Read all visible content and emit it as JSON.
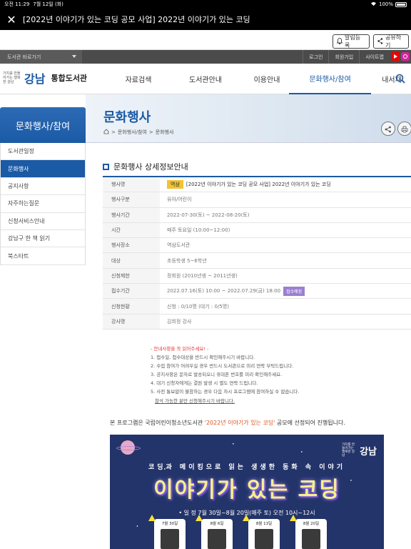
{
  "status_bar": {
    "time": "오전 11:29",
    "date": "7월 12일 (화)",
    "battery": "100%"
  },
  "window": {
    "title": "[2022년 이야기가 있는 코딩 공모 사업] 2022년 이야기가 있는 코딩"
  },
  "actions": {
    "alarm": "알림등록",
    "share": "공유하기"
  },
  "utility": {
    "library_select": "도서관 바로가기",
    "links": [
      "로그인",
      "회원가입",
      "사이트맵"
    ]
  },
  "header": {
    "logo_slogan": "가치를 만들어가는 행복한 강남",
    "logo_city": "강남",
    "logo_lib": "통합도서관",
    "nav": [
      "자료검색",
      "도서관안내",
      "이용안내",
      "문화행사/참여",
      "내서재"
    ]
  },
  "banner": {
    "title": "문화행사",
    "breadcrumb": [
      "문화행사/참여",
      "문화행사"
    ]
  },
  "sidebar": {
    "title": "문화행사/참여",
    "items": [
      "도서관일정",
      "문화행사",
      "공지사항",
      "자주하는질문",
      "신청서비스안내",
      "강남구 한 책 읽기",
      "북스타트"
    ]
  },
  "section_title": "문화행사 상세정보안내",
  "details": {
    "rows": [
      {
        "label": "행사명",
        "badge": "역삼",
        "value": "[2022년 이야기가 있는 코딩 공모 사업] 2022년 이야기가 있는 코딩"
      },
      {
        "label": "행사구분",
        "value": "유아/어린이"
      },
      {
        "label": "행사기간",
        "value": "2022-07-30(토) ~ 2022-08-20(토)"
      },
      {
        "label": "시간",
        "value": "매주 토요일 (10:00~12:00)"
      },
      {
        "label": "행사장소",
        "value": "역삼도서관"
      },
      {
        "label": "대상",
        "value": "초등학생 5~6학년"
      },
      {
        "label": "신청제한",
        "value": "정회원 (2010년생 ~ 2011년생)"
      },
      {
        "label": "접수기간",
        "value": "2022.07.16(토) 10:00 ~ 2022.07.29(금) 18:00",
        "status": "접수예정"
      },
      {
        "label": "신청현황",
        "value": "신청 : 0/10명 (대기 : 0/5명)"
      },
      {
        "label": "강사명",
        "value": "김희정 강사"
      }
    ]
  },
  "notice": {
    "heading": "- 안내사항을 꼭 읽어주세요! -",
    "items": [
      "1. 접수일, 접수대상을 반드시 확인해주시기 바랍니다.",
      "2. 수업 참여가 어려우실 경우 반드시 도서관으로 미리 연락 부탁드립니다.",
      "3. 공지사항은 문자로 발송되오니 휴대폰 번호를 미리 확인해주세요.",
      "4. 대기 신청자에게는 결원 발생 시 별도 연락 드립니다.",
      "5. 사전 통보없이 불참하는 경우 다음 차시 프로그램에 참여하실 수 없습니다."
    ],
    "link": "참석 가능한 분만 신청해주시기 바랍니다."
  },
  "intro": {
    "before": "본 프로그램은 국립어린이청소년도서관 ",
    "highlight": "'2022년 이야기가 있는 코딩'",
    "after": " 공모에 선정되어 진행됩니다."
  },
  "poster": {
    "logo_slogan": "가치를 만들어가는 행복한 강남",
    "logo_city": "강남",
    "subtitle": "코딩과 메이킹으로 읽는 생생한 동화 속 이야기",
    "main": "이야기가 있는 코딩",
    "schedule": "• 일 정 7월 30일~8월 20일(매주 토) 오전 10시~12시",
    "cards": [
      "7월 30일",
      "8월 6일",
      "8월 13일",
      "8월 20일"
    ]
  },
  "colors": {
    "primary": "#1b5aa4",
    "badge_branch": "#f1c232",
    "badge_status": "#9b7fd1",
    "highlight": "#d9531e"
  }
}
